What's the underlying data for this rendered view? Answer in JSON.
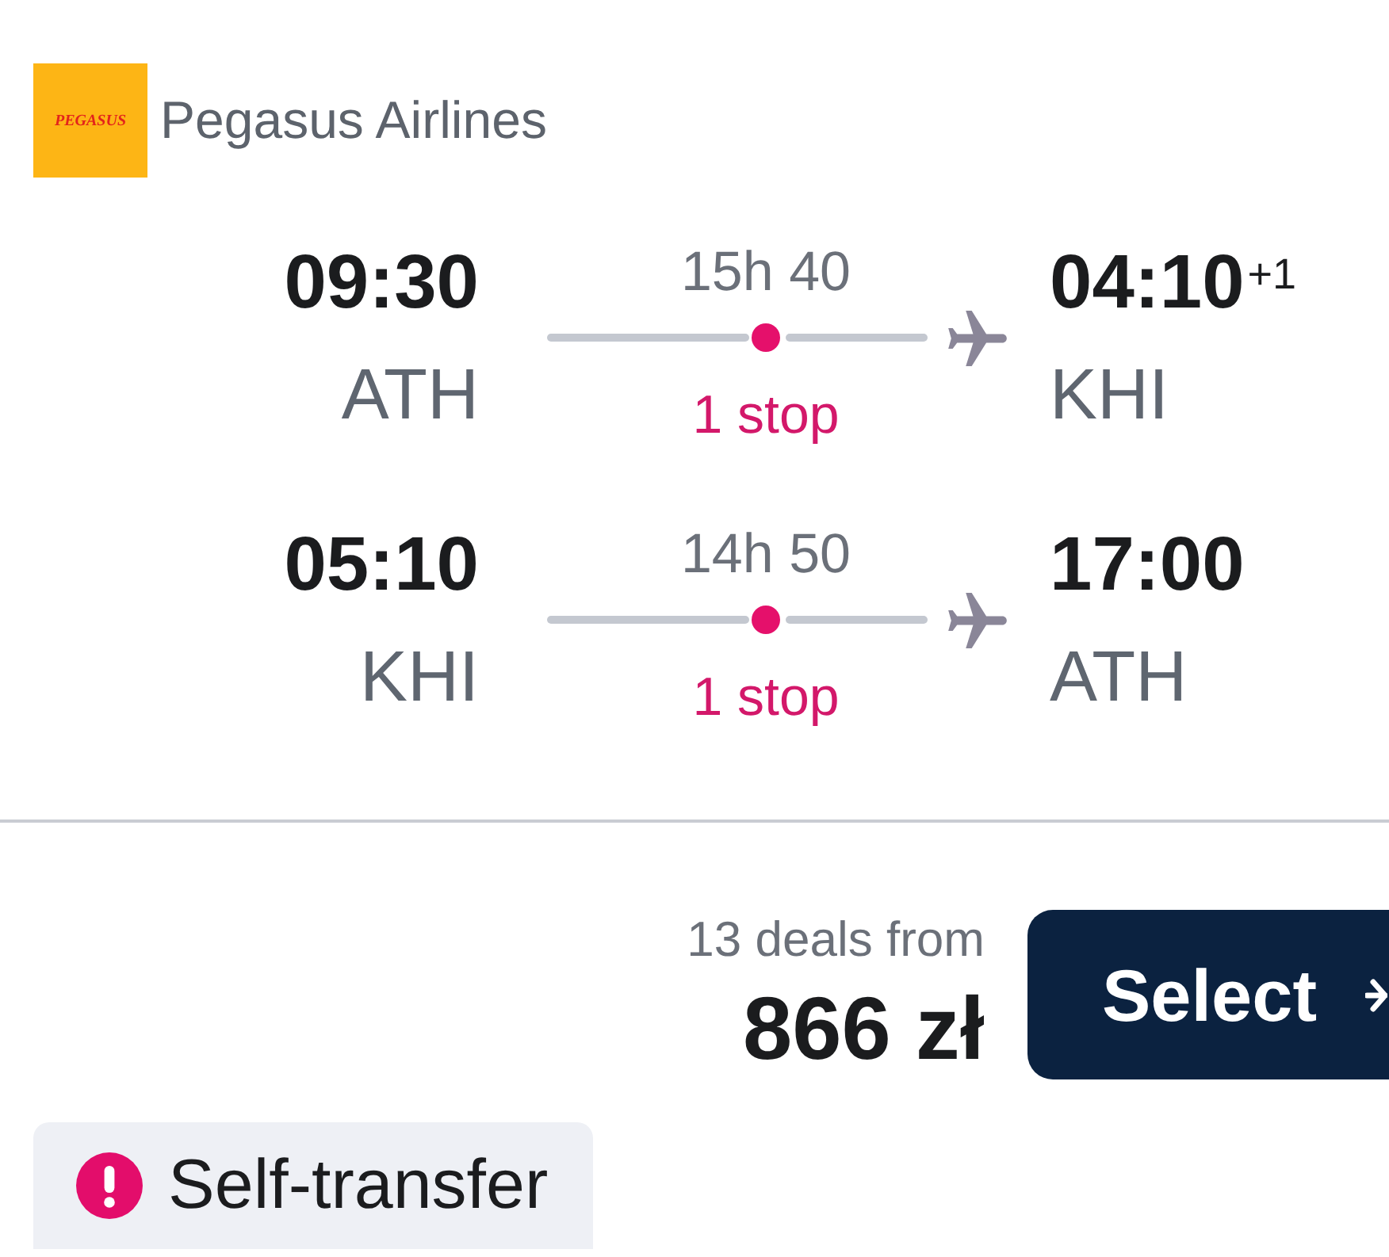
{
  "airline": {
    "logo_text": "PEGASUS",
    "name": "Pegasus Airlines"
  },
  "legs": [
    {
      "departure": {
        "time": "09:30",
        "airport": "ATH"
      },
      "duration": "15h 40",
      "stops": "1 stop",
      "arrival": {
        "time": "04:10",
        "day_offset": "+1",
        "airport": "KHI"
      }
    },
    {
      "departure": {
        "time": "05:10",
        "airport": "KHI"
      },
      "duration": "14h 50",
      "stops": "1 stop",
      "arrival": {
        "time": "17:00",
        "airport": "ATH"
      }
    }
  ],
  "price": {
    "deals": "13 deals from",
    "amount": "866 zł"
  },
  "select_button": {
    "label": "Select"
  },
  "notices": [
    {
      "kind": "warning",
      "label": "Self-transfer"
    }
  ]
}
